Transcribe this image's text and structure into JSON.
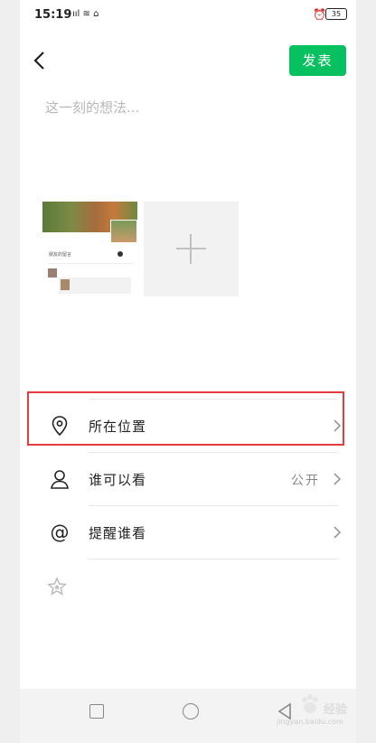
{
  "status_bar": {
    "time": "15:19",
    "signal": "ııl ≋ ⌂",
    "battery": "35"
  },
  "header": {
    "publish_label": "发表"
  },
  "compose": {
    "placeholder": "这一刻的想法..."
  },
  "thumbnail": {
    "caption": "朋友的留言"
  },
  "options": {
    "location_label": "所在位置",
    "visibility_label": "谁可以看",
    "visibility_value": "公开",
    "remind_label": "提醒谁看"
  },
  "watermark": {
    "text": "经验",
    "url": "jingyan.baidu.com"
  },
  "colors": {
    "accent": "#07c160",
    "highlight": "#e53c3c"
  }
}
